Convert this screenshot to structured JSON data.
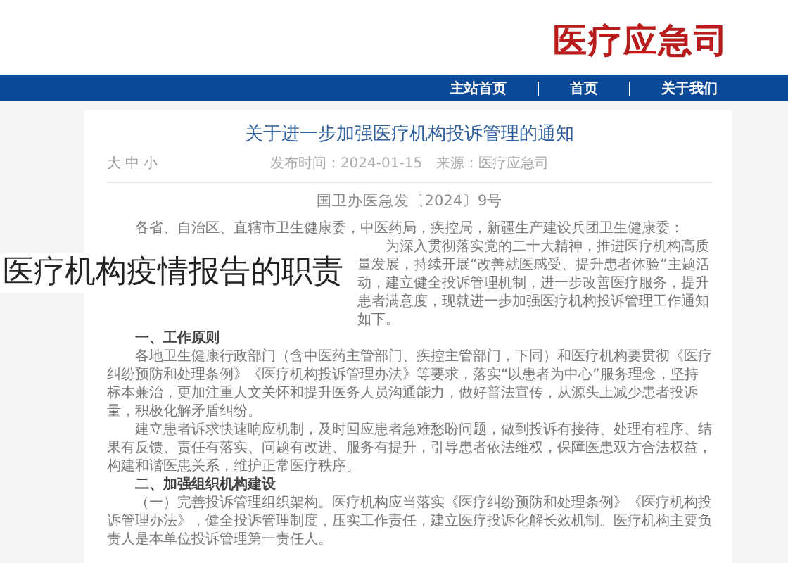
{
  "header": {
    "logo": "医疗应急司"
  },
  "nav": {
    "items": [
      "主站首页",
      "首页",
      "关于我们"
    ]
  },
  "article": {
    "title": "关于进一步加强医疗机构投诉管理的通知",
    "meta": "发布时间：2024-01-15　来源：医疗应急司",
    "font_sizes": [
      "大",
      "中",
      "小"
    ],
    "doc_number": "国卫办医急发〔2024〕9号",
    "blocks": [
      {
        "kind": "para",
        "text": "各省、自治区、直辖市卫生健康委，中医药局，疾控局，新疆生产建设兵团卫生健康委："
      },
      {
        "kind": "para",
        "text": "为深入贯彻落实党的二十大精神，推进医疗机构高质量发展，持续开展“改善就医感受、提升患者体验”主题活动，建立健全投诉管理机制，进一步改善医疗服务，提升患者满意度，现就进一步加强医疗机构投诉管理工作通知如下。"
      },
      {
        "kind": "heading",
        "text": "一、工作原则"
      },
      {
        "kind": "para",
        "text": "各地卫生健康行政部门（含中医药主管部门、疾控主管部门，下同）和医疗机构要贯彻《医疗纠纷预防和处理条例》《医疗机构投诉管理办法》等要求，落实“以患者为中心”服务理念，坚持标本兼治，更加注重人文关怀和提升医务人员沟通能力，做好普法宣传，从源头上减少患者投诉量，积极化解矛盾纠纷。"
      },
      {
        "kind": "para",
        "text": "建立患者诉求快速响应机制，及时回应患者急难愁盼问题，做到投诉有接待、处理有程序、结果有反馈、责任有落实、问题有改进、服务有提升，引导患者依法维权，保障医患双方合法权益，构建和谐医患关系，维护正常医疗秩序。"
      },
      {
        "kind": "heading",
        "text": "二、加强组织机构建设"
      },
      {
        "kind": "para",
        "text": "（一）完善投诉管理组织架构。医疗机构应当落实《医疗纠纷预防和处理条例》《医疗机构投诉管理办法》，健全投诉管理制度，压实工作责任，建立医疗投诉化解长效机制。医疗机构主要负责人是本单位投诉管理第一责任人。"
      }
    ]
  },
  "caption": "医疗机构疫情报告的职责"
}
